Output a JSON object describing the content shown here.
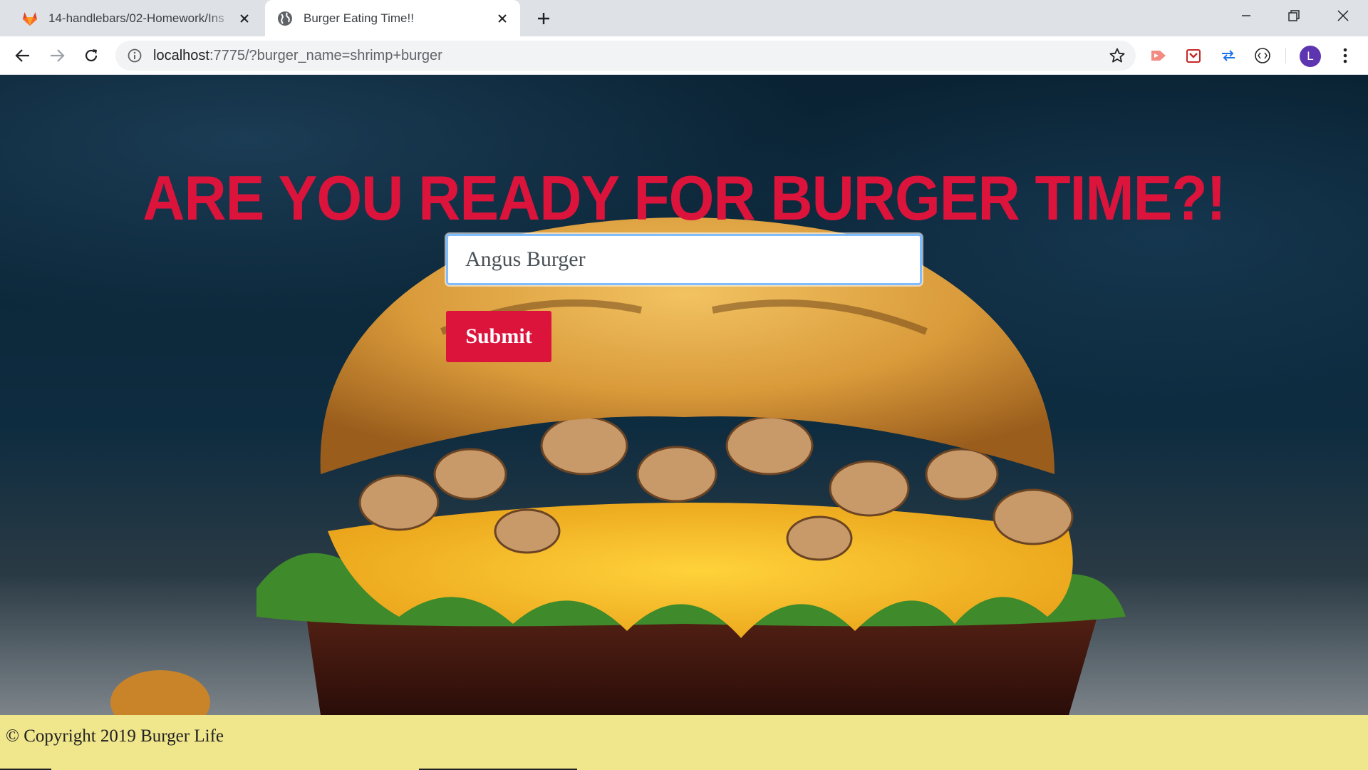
{
  "browser": {
    "tabs": [
      {
        "title": "14-handlebars/02-Homework/Ins",
        "favicon": "gitlab-icon",
        "active": false
      },
      {
        "title": "Burger Eating Time!!",
        "favicon": "globe-icon",
        "active": true
      }
    ],
    "address": {
      "host": "localhost",
      "rest": ":7775/?burger_name=shrimp+burger"
    },
    "profile_initial": "L"
  },
  "page": {
    "headline": "ARE YOU READY FOR BURGER TIME?!",
    "input_value": "Angus Burger",
    "submit_label": "Submit",
    "footer_text": "© Copyright 2019 Burger Life",
    "colors": {
      "accent": "#dc143c",
      "footer": "#f0e68c",
      "background": "#0e2c40"
    }
  }
}
